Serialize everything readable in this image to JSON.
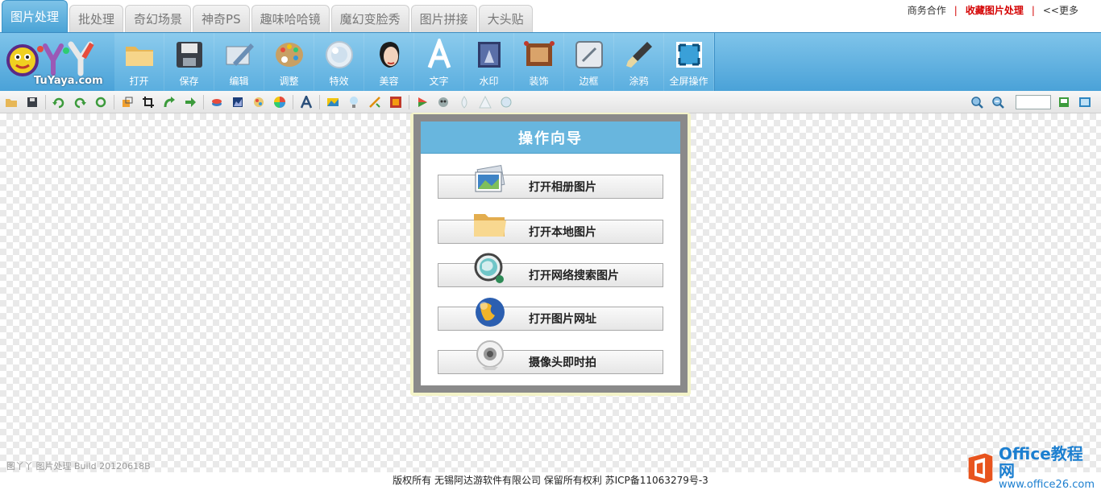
{
  "tabs": [
    {
      "label": "图片处理",
      "active": true
    },
    {
      "label": "批处理"
    },
    {
      "label": "奇幻场景"
    },
    {
      "label": "神奇PS"
    },
    {
      "label": "趣味哈哈镜"
    },
    {
      "label": "魔幻变脸秀"
    },
    {
      "label": "图片拼接"
    },
    {
      "label": "大头贴"
    }
  ],
  "top_links": {
    "business": "商务合作",
    "sep": "|",
    "favorite": "收藏图片处理",
    "more": "<<更多"
  },
  "logo": {
    "text": "TuYaya.com",
    "icon": "tuyaya-logo"
  },
  "tools": [
    {
      "label": "打开",
      "icon": "folder-icon"
    },
    {
      "label": "保存",
      "icon": "floppy-icon"
    },
    {
      "label": "编辑",
      "icon": "edit-icon"
    },
    {
      "label": "调整",
      "icon": "palette-icon"
    },
    {
      "label": "特效",
      "icon": "effect-icon"
    },
    {
      "label": "美容",
      "icon": "face-icon"
    },
    {
      "label": "文字",
      "icon": "text-icon"
    },
    {
      "label": "水印",
      "icon": "watermark-icon"
    },
    {
      "label": "装饰",
      "icon": "decorate-icon"
    },
    {
      "label": "边框",
      "icon": "frame-icon"
    },
    {
      "label": "涂鸦",
      "icon": "brush-icon"
    },
    {
      "label": "全屏操作",
      "icon": "fullscreen-icon"
    }
  ],
  "zoom": {
    "value": ""
  },
  "dialog": {
    "title": "操作向导",
    "buttons": [
      {
        "label": "打开相册图片",
        "icon": "album-icon"
      },
      {
        "label": "打开本地图片",
        "icon": "local-folder-icon"
      },
      {
        "label": "打开网络搜索图片",
        "icon": "web-search-icon"
      },
      {
        "label": "打开图片网址",
        "icon": "globe-icon"
      },
      {
        "label": "摄像头即时拍",
        "icon": "webcam-icon"
      }
    ]
  },
  "build_text": "图丫丫 图片处理 Build 20120618B",
  "footer": "版权所有 无锡阿达游软件有限公司 保留所有权利 苏ICP备11063279号-3",
  "watermark": {
    "line1": "Office教程网",
    "line2": "www.office26.com"
  },
  "colors": {
    "toolbar": "#5aaedf",
    "dialog_title": "#68b6de",
    "favorite_link": "#d40000"
  }
}
